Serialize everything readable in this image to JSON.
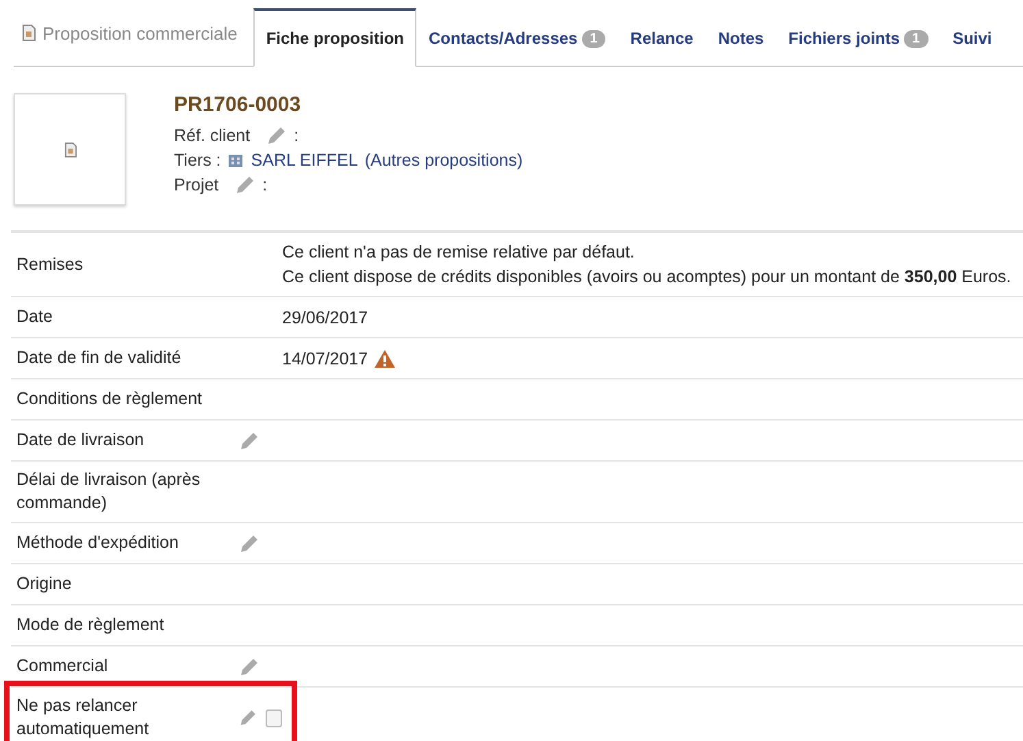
{
  "tabs": [
    {
      "label": "Proposition commerciale",
      "kind": "title"
    },
    {
      "label": "Fiche proposition",
      "selected": true,
      "kind": "tab"
    },
    {
      "label": "Contacts/Adresses",
      "selected": false,
      "kind": "tab",
      "badge": "1"
    },
    {
      "label": "Relance",
      "selected": false,
      "kind": "tab"
    },
    {
      "label": "Notes",
      "selected": false,
      "kind": "tab"
    },
    {
      "label": "Fichiers joints",
      "selected": false,
      "kind": "tab",
      "badge": "1"
    },
    {
      "label": "Suivi",
      "selected": false,
      "kind": "tab"
    }
  ],
  "header": {
    "ref": "PR1706-0003",
    "ref_client_label": "Réf. client",
    "tiers_label": "Tiers :",
    "tiers_link": "SARL EIFFEL",
    "tiers_extra": "(Autres propositions)",
    "projet_label": "Projet",
    "ref_client_colon": ":",
    "projet_colon": ":"
  },
  "rows": [
    {
      "label": "Remises",
      "editable": false,
      "lines": [
        "Ce client n'a pas de remise relative par défaut.",
        "Ce client dispose de crédits disponibles (avoirs ou acomptes) pour un montant de **350,00** Euros."
      ]
    },
    {
      "label": "Date",
      "editable": false,
      "lines": [
        "29/06/2017"
      ]
    },
    {
      "label": "Date de fin de validité",
      "editable": false,
      "lines": [
        "14/07/2017"
      ],
      "warning": true
    },
    {
      "label": "Conditions de règlement",
      "editable": false
    },
    {
      "label": "Date de livraison",
      "editable": true
    },
    {
      "label": "Délai de livraison (après commande)",
      "editable": false
    },
    {
      "label": "Méthode d'expédition",
      "editable": true
    },
    {
      "label": "Origine",
      "editable": false
    },
    {
      "label": "Mode de règlement",
      "editable": false
    },
    {
      "label": "Commercial",
      "editable": true
    },
    {
      "label": "Ne pas relancer automatiquement",
      "editable": true,
      "checked": false,
      "highlighted": true
    }
  ]
}
